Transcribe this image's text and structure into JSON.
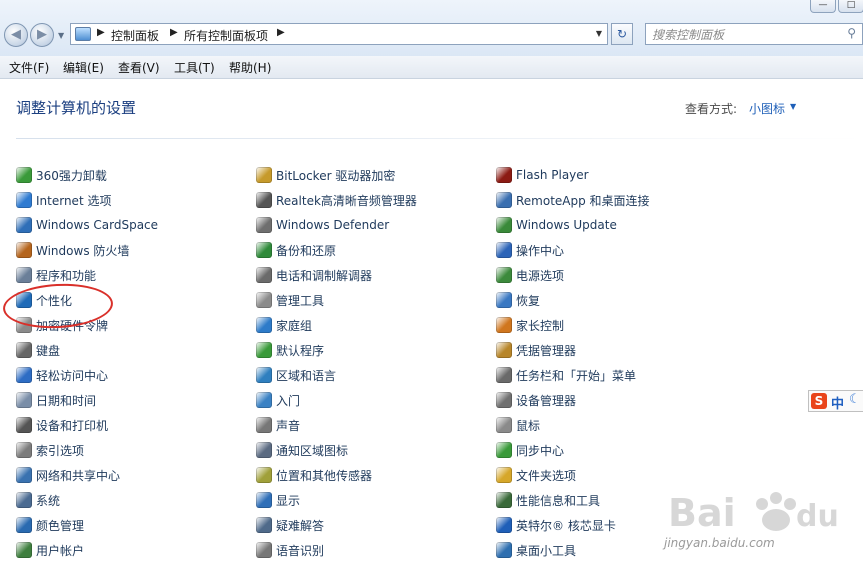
{
  "address_bar": {
    "breadcrumb": [
      "控制面板",
      "所有控制面板项"
    ],
    "search_placeholder": "搜索控制面板"
  },
  "menu": [
    "文件(F)",
    "编辑(E)",
    "查看(V)",
    "工具(T)",
    "帮助(H)"
  ],
  "header": {
    "title": "调整计算机的设置",
    "view_by_label": "查看方式:",
    "view_by_value": "小图标"
  },
  "columns": [
    [
      {
        "label": "360强力卸载",
        "icon": "uninstall-icon",
        "color": "#3a9a3a"
      },
      {
        "label": "Internet 选项",
        "icon": "internet-options-icon",
        "color": "#2f7bd1"
      },
      {
        "label": "Windows CardSpace",
        "icon": "cardspace-icon",
        "color": "#2f6fb8"
      },
      {
        "label": "Windows 防火墙",
        "icon": "firewall-icon",
        "color": "#b5651d"
      },
      {
        "label": "程序和功能",
        "icon": "programs-icon",
        "color": "#6b7f99"
      },
      {
        "label": "个性化",
        "icon": "personalization-icon",
        "color": "#1f6bb8"
      },
      {
        "label": "加密硬件令牌",
        "icon": "crypto-token-icon",
        "color": "#8a8a8a"
      },
      {
        "label": "键盘",
        "icon": "keyboard-icon",
        "color": "#666666"
      },
      {
        "label": "轻松访问中心",
        "icon": "ease-of-access-icon",
        "color": "#2e6dc4"
      },
      {
        "label": "日期和时间",
        "icon": "clock-icon",
        "color": "#7a8ea8"
      },
      {
        "label": "设备和打印机",
        "icon": "printer-icon",
        "color": "#555555"
      },
      {
        "label": "索引选项",
        "icon": "indexing-icon",
        "color": "#7c7c7c"
      },
      {
        "label": "网络和共享中心",
        "icon": "network-icon",
        "color": "#3a72b0"
      },
      {
        "label": "系统",
        "icon": "system-icon",
        "color": "#4b6b92"
      },
      {
        "label": "颜色管理",
        "icon": "color-management-icon",
        "color": "#2a6ab0"
      },
      {
        "label": "用户帐户",
        "icon": "user-accounts-icon",
        "color": "#3f7f3f"
      }
    ],
    [
      {
        "label": "BitLocker 驱动器加密",
        "icon": "bitlocker-icon",
        "color": "#c69a2b"
      },
      {
        "label": "Realtek高清晰音频管理器",
        "icon": "audio-manager-icon",
        "color": "#555555"
      },
      {
        "label": "Windows Defender",
        "icon": "defender-icon",
        "color": "#6f6f6f"
      },
      {
        "label": "备份和还原",
        "icon": "backup-icon",
        "color": "#2f8a3a"
      },
      {
        "label": "电话和调制解调器",
        "icon": "phone-modem-icon",
        "color": "#6b6b6b"
      },
      {
        "label": "管理工具",
        "icon": "admin-tools-icon",
        "color": "#8b8b8b"
      },
      {
        "label": "家庭组",
        "icon": "homegroup-icon",
        "color": "#2e7bc9"
      },
      {
        "label": "默认程序",
        "icon": "default-programs-icon",
        "color": "#3a9a3a"
      },
      {
        "label": "区域和语言",
        "icon": "region-language-icon",
        "color": "#2f7fbf"
      },
      {
        "label": "入门",
        "icon": "getting-started-icon",
        "color": "#3b82c4"
      },
      {
        "label": "声音",
        "icon": "speaker-icon",
        "color": "#777777"
      },
      {
        "label": "通知区域图标",
        "icon": "notification-icon",
        "color": "#5b6b82"
      },
      {
        "label": "位置和其他传感器",
        "icon": "sensor-icon",
        "color": "#a0a03a"
      },
      {
        "label": "显示",
        "icon": "display-icon",
        "color": "#2f6fb8"
      },
      {
        "label": "疑难解答",
        "icon": "troubleshoot-icon",
        "color": "#4f6a8a"
      },
      {
        "label": "语音识别",
        "icon": "microphone-icon",
        "color": "#777777"
      }
    ],
    [
      {
        "label": "Flash Player",
        "icon": "flash-icon",
        "color": "#8c1b14"
      },
      {
        "label": "RemoteApp 和桌面连接",
        "icon": "remoteapp-icon",
        "color": "#3a6fb0"
      },
      {
        "label": "Windows Update",
        "icon": "windows-update-icon",
        "color": "#3a8a3a"
      },
      {
        "label": "操作中心",
        "icon": "action-center-flag-icon",
        "color": "#2c64b8"
      },
      {
        "label": "电源选项",
        "icon": "power-icon",
        "color": "#3c8a3c"
      },
      {
        "label": "恢复",
        "icon": "recovery-icon",
        "color": "#3a78c2"
      },
      {
        "label": "家长控制",
        "icon": "parental-controls-icon",
        "color": "#d0761e"
      },
      {
        "label": "凭据管理器",
        "icon": "credential-icon",
        "color": "#b8862a"
      },
      {
        "label": "任务栏和「开始」菜单",
        "icon": "taskbar-icon",
        "color": "#6a6a6a"
      },
      {
        "label": "设备管理器",
        "icon": "device-manager-icon",
        "color": "#707070"
      },
      {
        "label": "鼠标",
        "icon": "mouse-icon",
        "color": "#8a8a8a"
      },
      {
        "label": "同步中心",
        "icon": "sync-icon",
        "color": "#3a9a3a"
      },
      {
        "label": "文件夹选项",
        "icon": "folder-icon",
        "color": "#d6a72a"
      },
      {
        "label": "性能信息和工具",
        "icon": "performance-icon",
        "color": "#3a6a3a"
      },
      {
        "label": "英特尔® 核芯显卡",
        "icon": "intel-graphics-icon",
        "color": "#1f5fb8"
      },
      {
        "label": "桌面小工具",
        "icon": "gadgets-icon",
        "color": "#2e6fb0"
      }
    ]
  ],
  "ime": {
    "label": "中"
  },
  "watermark": {
    "text": "jingyan.baidu.com"
  }
}
